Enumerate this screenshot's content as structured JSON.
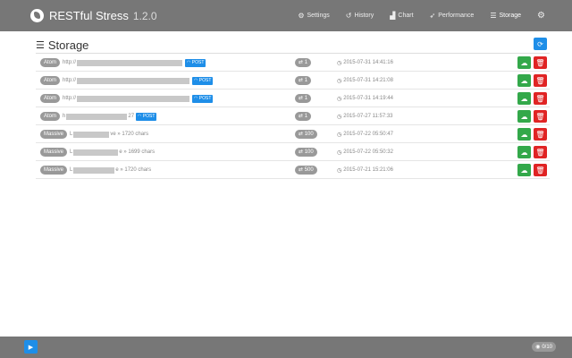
{
  "app": {
    "name": "RESTful Stress",
    "version": "1.2.0"
  },
  "nav": {
    "items": [
      {
        "label": "Settings",
        "icon": "gears-icon"
      },
      {
        "label": "History",
        "icon": "history-icon"
      },
      {
        "label": "Chart",
        "icon": "area-chart-icon"
      },
      {
        "label": "Performance",
        "icon": "rocket-icon"
      },
      {
        "label": "Storage",
        "icon": "database-icon",
        "active": true
      }
    ],
    "extra_icon": "gear-icon"
  },
  "page": {
    "title": "Storage"
  },
  "rows": [
    {
      "type": "Atom",
      "url_prefix": "http://",
      "url_suffix": "",
      "size_suffix": "",
      "method": "POST",
      "count": "1",
      "date": "2015-07-31 14:41:16"
    },
    {
      "type": "Atom",
      "url_prefix": "http://",
      "url_suffix": "",
      "size_suffix": "",
      "method": "POST",
      "count": "1",
      "date": "2015-07-31 14:21:08"
    },
    {
      "type": "Atom",
      "url_prefix": "http://",
      "url_suffix": "",
      "size_suffix": "",
      "method": "POST",
      "count": "1",
      "date": "2015-07-31 14:19:44"
    },
    {
      "type": "Atom",
      "url_prefix": "h",
      "url_suffix": "27",
      "size_suffix": "",
      "method": "POST",
      "count": "1",
      "date": "2015-07-27 11:57:33"
    },
    {
      "type": "Massive",
      "url_prefix": "L",
      "url_suffix": "ve",
      "size_suffix": "» 1720 chars",
      "method": "",
      "count": "100",
      "date": "2015-07-22 05:50:47"
    },
    {
      "type": "Massive",
      "url_prefix": "L",
      "url_suffix": "e",
      "size_suffix": "» 1699 chars",
      "method": "",
      "count": "100",
      "date": "2015-07-22 05:50:32"
    },
    {
      "type": "Massive",
      "url_prefix": "L",
      "url_suffix": "e",
      "size_suffix": "» 1720 chars",
      "method": "",
      "count": "500",
      "date": "2015-07-21 15:21:06"
    }
  ],
  "footer": {
    "progress": "0/10",
    "progress_icon": "eye-icon",
    "play_icon": "play-icon"
  },
  "colors": {
    "navbar": "#777777",
    "primary": "#1e8ee8",
    "success": "#33a84a",
    "danger": "#e02424",
    "badge": "#999999"
  }
}
